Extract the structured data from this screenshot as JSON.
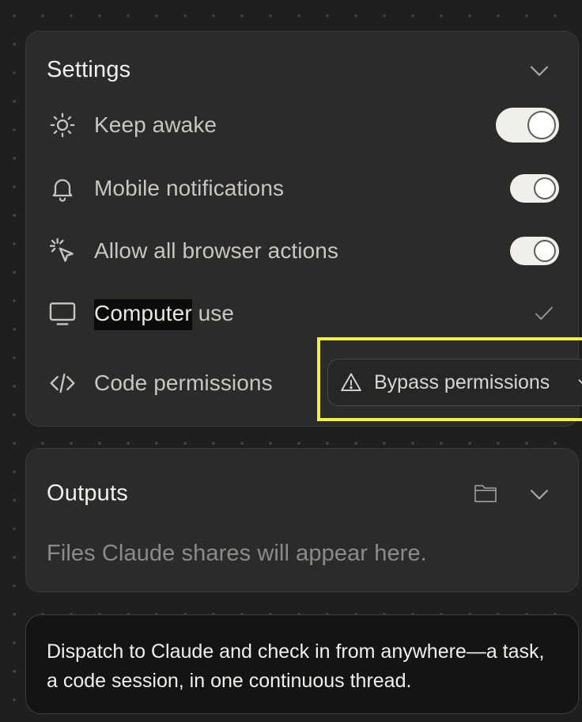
{
  "settings": {
    "title": "Settings",
    "items": [
      {
        "label": "Keep awake",
        "icon": "sun-icon",
        "control": "toggle",
        "on": true
      },
      {
        "label": "Mobile notifications",
        "icon": "bell-icon",
        "control": "toggle",
        "on": true
      },
      {
        "label": "Allow all browser actions",
        "icon": "cursor-click-icon",
        "control": "toggle",
        "on": true
      },
      {
        "label_highlighted": "Computer",
        "label_rest": " use",
        "icon": "monitor-icon",
        "control": "check",
        "checked": true
      },
      {
        "label": "Code permissions",
        "icon": "code-icon",
        "control": "select"
      }
    ],
    "code_permissions_value": "Bypass permissions"
  },
  "outputs": {
    "title": "Outputs",
    "empty_text": "Files Claude shares will appear here."
  },
  "promo": {
    "text": "Dispatch to Claude and check in from anywhere—a task, a code session, in one continuous thread."
  },
  "colors": {
    "background": "#1f1f1e",
    "panel": "#2b2b2a",
    "toggle_on": "#f1efe9",
    "highlight_outline": "#f2ee4a"
  }
}
